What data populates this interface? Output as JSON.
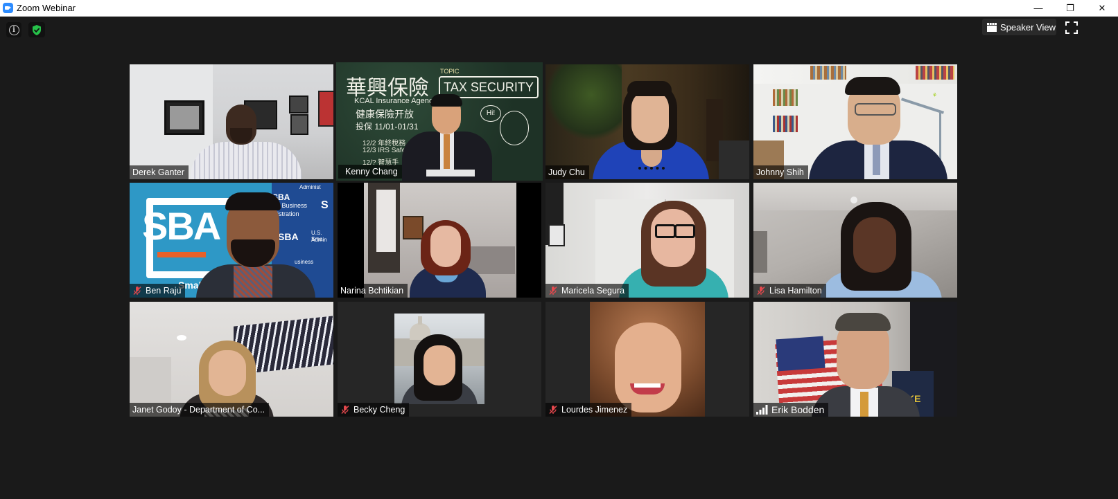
{
  "window": {
    "title": "Zoom Webinar",
    "controls": {
      "minimize": "—",
      "restore": "❐",
      "close": "✕"
    }
  },
  "toolbar": {
    "speaker_view_label": "Speaker View"
  },
  "participants": [
    {
      "name": "Derek Ganter",
      "muted": false
    },
    {
      "name": "Kenny Chang",
      "muted": false,
      "active": true
    },
    {
      "name": "Judy Chu",
      "muted": false
    },
    {
      "name": "Johnny Shih",
      "muted": false
    },
    {
      "name": "Ben Raju",
      "muted": true
    },
    {
      "name": "Narina Bchtikian",
      "muted": false
    },
    {
      "name": "Maricela Segura",
      "muted": true
    },
    {
      "name": "Lisa Hamilton",
      "muted": true
    },
    {
      "name": "Janet Godoy - Department of Co...",
      "muted": false
    },
    {
      "name": "Becky Cheng",
      "muted": true
    },
    {
      "name": "Lourdes Jimenez",
      "muted": true
    },
    {
      "name": "Erik Bodden",
      "muted": false,
      "signal": true
    }
  ],
  "backgrounds": {
    "kenny_board": {
      "chinese_title": "華興保險",
      "agency": "KCAL Insurance Agency",
      "line2": "健康保險开放",
      "line3": "投保 11/01-01/31",
      "topic_label": "TOPIC",
      "topic": "TAX SECURITY",
      "bubble": "Hi!",
      "list1": "12/2 年終稅務",
      "list2": "12/3 IRS Safe",
      "list3": "12/? 智慧手"
    },
    "ben_banner": {
      "logo": "SBA",
      "line1": "all Business",
      "line2": "nistration",
      "line3": "U.S. Sma",
      "line4": "Admin",
      "line5": "usiness",
      "line6": "Small Bu",
      "top_right": "Administ"
    },
    "erik_jacket": "KE"
  },
  "colors": {
    "active_speaker_outline": "#e3f16a",
    "mic_off_red": "#e5484d",
    "zoom_blue": "#2d8cff",
    "shield_green": "#26c24a"
  }
}
